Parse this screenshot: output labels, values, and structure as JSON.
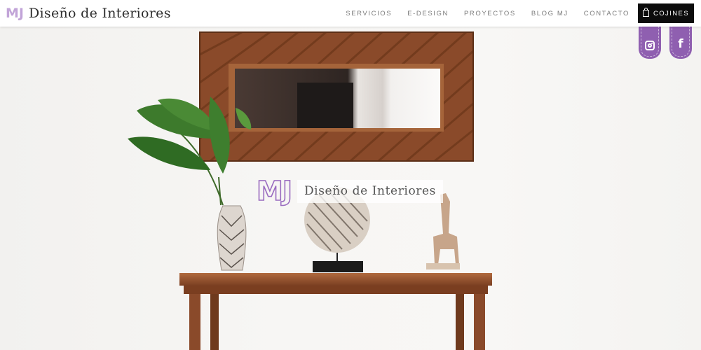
{
  "brand": {
    "mark": "MJ",
    "name": "Diseño de Interiores"
  },
  "nav": {
    "items": [
      "SERVICIOS",
      "E-DESIGN",
      "PROYECTOS",
      "BLOG MJ",
      "CONTACTO"
    ],
    "cart_label": "COJINES"
  },
  "social": {
    "instagram_icon": "instagram-icon",
    "facebook_icon": "facebook-icon",
    "facebook_glyph": "f"
  },
  "hero": {
    "logo_mark": "MJ",
    "logo_text": "Diseño de Interiores"
  },
  "colors": {
    "accent": "#9a6cc0",
    "logo_light": "#c2a4d8",
    "cart_bg": "#0c0c0c",
    "wood": "#8a4a2a"
  }
}
